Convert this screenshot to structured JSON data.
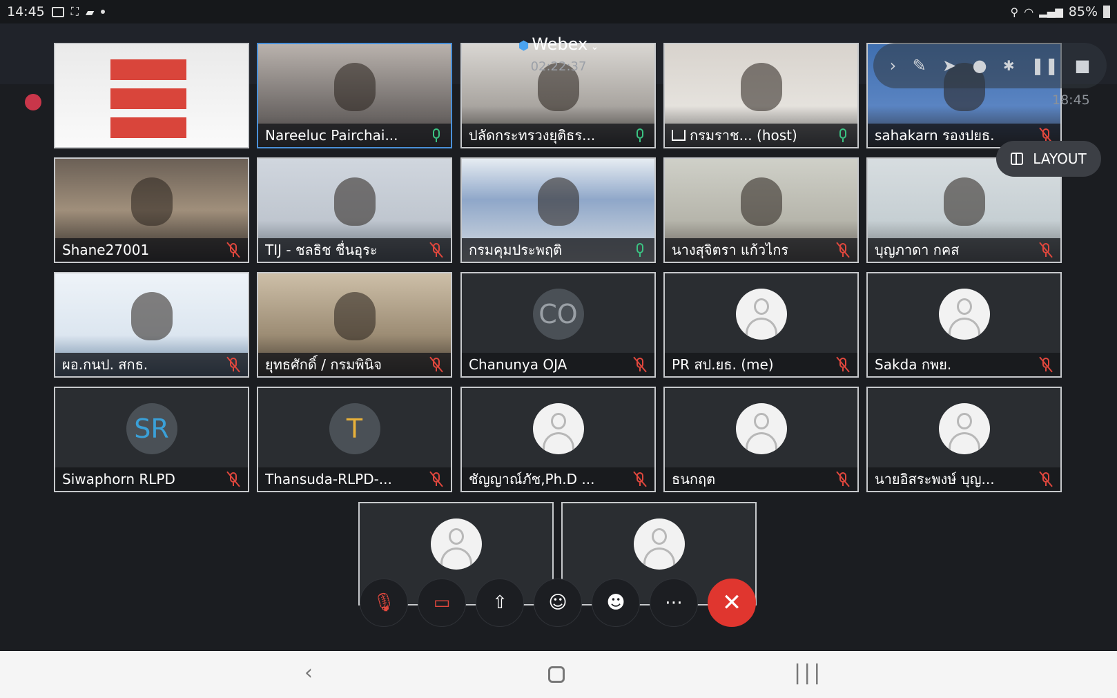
{
  "status_bar": {
    "time": "14:45",
    "battery": "85%"
  },
  "meeting": {
    "app_title": "Webex",
    "elapsed": "02:22:37",
    "annotation_clock": "18:45"
  },
  "layout_button": {
    "label": "LAYOUT"
  },
  "annotation_toolbar": {
    "icons": [
      "chevron-right-icon",
      "pen-icon",
      "pointer-icon",
      "person-icon",
      "pause-icon",
      "stop-icon"
    ]
  },
  "participants": [
    {
      "name": "",
      "type": "screen-share",
      "mic": "none"
    },
    {
      "name": "Nareeluc Pairchai...",
      "type": "video",
      "mic": "on",
      "active": true
    },
    {
      "name": "ปลัดกระทรวงยุติธร...",
      "type": "video",
      "mic": "on"
    },
    {
      "name": "กรมราช... (host)",
      "type": "video",
      "mic": "on",
      "sharing": true
    },
    {
      "name": "sahakarn รองปยธ.",
      "type": "video",
      "mic": "muted"
    },
    {
      "name": "Shane27001",
      "type": "video",
      "mic": "muted"
    },
    {
      "name": "TIJ - ชลธิช ชื่นอุระ",
      "type": "video",
      "mic": "muted"
    },
    {
      "name": "กรมคุมประพฤติ",
      "type": "video",
      "mic": "on"
    },
    {
      "name": "นางสุจิตรา แก้วไกร",
      "type": "video",
      "mic": "muted"
    },
    {
      "name": "บุญภาดา กคส",
      "type": "video",
      "mic": "muted"
    },
    {
      "name": "ผอ.กนป. สกธ.",
      "type": "video",
      "mic": "muted"
    },
    {
      "name": "ยุทธศักดิ์ / กรมพินิจ",
      "type": "video",
      "mic": "muted"
    },
    {
      "name": "Chanunya OJA",
      "type": "initials",
      "initials": "CO",
      "mic": "muted"
    },
    {
      "name": "PR สป.ยธ. (me)",
      "type": "avatar",
      "mic": "muted"
    },
    {
      "name": "Sakda กพย.",
      "type": "avatar",
      "mic": "muted"
    },
    {
      "name": "Siwaphorn RLPD",
      "type": "initials",
      "initials": "SR",
      "initials_color": "#3aa0d8",
      "mic": "muted"
    },
    {
      "name": "Thansuda-RLPD-...",
      "type": "initials",
      "initials": "T",
      "initials_color": "#e8b13a",
      "mic": "muted"
    },
    {
      "name": "ชัญญาณ์ภัช,Ph.D ...",
      "type": "avatar",
      "mic": "muted"
    },
    {
      "name": "ธนกฤต",
      "type": "avatar",
      "mic": "muted"
    },
    {
      "name": "นายอิสระพงษ์ บุญ...",
      "type": "avatar",
      "mic": "muted"
    },
    {
      "name": "",
      "type": "avatar",
      "mic": "muted"
    },
    {
      "name": "",
      "type": "avatar",
      "mic": "muted"
    }
  ],
  "controls": [
    {
      "name": "mute-button",
      "icon": "mic-off-icon"
    },
    {
      "name": "video-button",
      "icon": "video-off-icon"
    },
    {
      "name": "share-button",
      "icon": "share-icon"
    },
    {
      "name": "participants-button",
      "icon": "participants-icon"
    },
    {
      "name": "reactions-button",
      "icon": "emoji-icon"
    },
    {
      "name": "more-button",
      "icon": "more-icon"
    },
    {
      "name": "end-call-button",
      "icon": "close-icon"
    }
  ],
  "colors": {
    "muted": "#e0473d",
    "unmuted": "#3bc483",
    "end_call": "#e0362f",
    "active_border": "#4a90d9"
  }
}
